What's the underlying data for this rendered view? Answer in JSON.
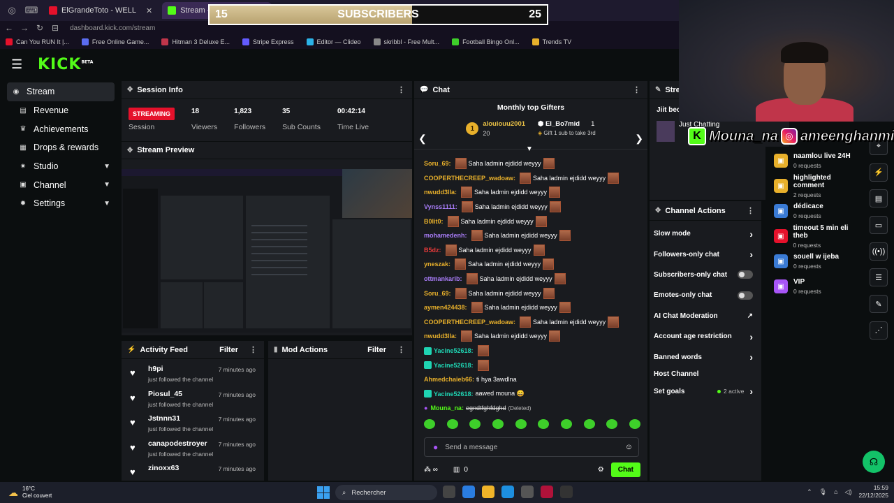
{
  "browser": {
    "tabs": [
      {
        "label": "ElGrandeToto - WELL",
        "active": false
      },
      {
        "label": "Stream - Kick Dashboard",
        "active": true
      }
    ],
    "url": "dashboard.kick.com/stream",
    "bookmarks": [
      "Can You RUN It |...",
      "Free Online Game...",
      "Hitman 3 Deluxe E...",
      "Stripe Express",
      "Editor — Clideo",
      "skribbl - Free Mult...",
      "Football Bingo Onl...",
      "Trends TV"
    ]
  },
  "overlay": {
    "current": "15",
    "title": "SUBSCRIBERS",
    "goal": "25",
    "progress": 0.6,
    "handle": "Mouna_na",
    "instagram": "ameenghanmii"
  },
  "brand": {
    "logo": "KICK",
    "beta": "BETA",
    "accent": "#53fc18"
  },
  "sidebar": {
    "items": [
      {
        "label": "Stream",
        "icon": "broadcast-icon"
      },
      {
        "label": "Revenue",
        "icon": "revenue-icon"
      },
      {
        "label": "Achievements",
        "icon": "trophy-icon"
      },
      {
        "label": "Drops & rewards",
        "icon": "gift-icon"
      },
      {
        "label": "Studio",
        "icon": "gear-icon"
      },
      {
        "label": "Channel",
        "icon": "channel-icon"
      },
      {
        "label": "Settings",
        "icon": "gear-icon"
      }
    ]
  },
  "session": {
    "title": "Session Info",
    "status": "STREAMING",
    "status_label": "Session",
    "stats": [
      {
        "value": "18",
        "label": "Viewers"
      },
      {
        "value": "1,823",
        "label": "Followers"
      },
      {
        "value": "35",
        "label": "Sub Counts"
      },
      {
        "value": "00:42:14",
        "label": "Time Live"
      }
    ]
  },
  "preview": {
    "title": "Stream Preview"
  },
  "activity": {
    "title": "Activity Feed",
    "filter": "Filter",
    "items": [
      {
        "name": "h9pi",
        "action": "just followed the channel",
        "time": "7 minutes ago"
      },
      {
        "name": "Piosul_45",
        "action": "just followed the channel",
        "time": "7 minutes ago"
      },
      {
        "name": "Jstnnn31",
        "action": "just followed the channel",
        "time": "7 minutes ago"
      },
      {
        "name": "canapodestroyer",
        "action": "just followed the channel",
        "time": "7 minutes ago"
      },
      {
        "name": "zinoxx63",
        "action": "",
        "time": "7 minutes ago"
      }
    ]
  },
  "mod": {
    "title": "Mod Actions",
    "filter": "Filter"
  },
  "chat": {
    "title": "Chat",
    "gifters_title": "Monthly top Gifters",
    "top": {
      "rank": "1",
      "name": "alouiouu2001",
      "count": "20"
    },
    "second": {
      "name": "El_Bo7mid",
      "count": "1",
      "note": "Gift 1 sub to take 3rd"
    },
    "messages": [
      {
        "user": "Soru_69:",
        "color": "#e8b02b",
        "text": "Saha ladmin ejdidd weyyy",
        "emotes": true
      },
      {
        "user": "COOPERTHECREEP_wadoaw:",
        "color": "#e8b02b",
        "text": "Saha ladmin ejdidd weyyy",
        "emotes": true
      },
      {
        "user": "nwudd3lla:",
        "color": "#e8b02b",
        "text": "Saha ladmin ejdidd weyyy",
        "emotes": true
      },
      {
        "user": "Vynss1111:",
        "color": "#a87cf7",
        "text": "Saha ladmin ejdidd weyyy",
        "emotes": true
      },
      {
        "user": "B0lit0:",
        "color": "#e8b02b",
        "text": "Saha ladmin ejdidd weyyy",
        "emotes": true
      },
      {
        "user": "mohamedenh:",
        "color": "#a87cf7",
        "text": "Saha ladmin ejdidd weyyy",
        "emotes": true
      },
      {
        "user": "B5dz:",
        "color": "#e83a3a",
        "text": "Saha ladmin ejdidd weyyy",
        "emotes": true
      },
      {
        "user": "yneszak:",
        "color": "#e8b02b",
        "text": "Saha ladmin ejdidd weyyy",
        "emotes": true
      },
      {
        "user": "ottmankarib:",
        "color": "#a87cf7",
        "text": "Saha ladmin ejdidd weyyy",
        "emotes": true
      },
      {
        "user": "Soru_69:",
        "color": "#e8b02b",
        "text": "Saha ladmin ejdidd weyyy",
        "emotes": true
      },
      {
        "user": "aymen424438:",
        "color": "#e8b02b",
        "text": "Saha ladmin ejdidd weyyy",
        "emotes": true
      },
      {
        "user": "COOPERTHECREEP_wadoaw:",
        "color": "#e8b02b",
        "text": "Saha ladmin ejdidd weyyy",
        "emotes": true
      },
      {
        "user": "nwudd3lla:",
        "color": "#e8b02b",
        "text": "Saha ladmin ejdidd weyyy",
        "emotes": true
      },
      {
        "user": "Yacine52618:",
        "color": "#1fd4b3",
        "text": "",
        "emotes": true,
        "badge": true
      },
      {
        "user": "Yacine52618:",
        "color": "#1fd4b3",
        "text": "",
        "emotes": true,
        "badge": true
      },
      {
        "user": "Ahmedchaieb66:",
        "color": "#e8b02b",
        "text": "ti hya 3awdlna",
        "emotes": false
      },
      {
        "user": "Yacine52618:",
        "color": "#1fd4b3",
        "text": "aawed mouna 😄",
        "emotes": false,
        "badge": true
      },
      {
        "user": "Mouna_na:",
        "color": "#53fc18",
        "text": "egndtfghfdghd",
        "emotes": false,
        "deleted": "(Deleted)"
      }
    ],
    "placeholder": "Send a message",
    "send": "Chat",
    "foot_count": "0"
  },
  "stream_panel": {
    "title": "Strea",
    "partial_title": "Jiit bec",
    "category": "Just Chatting"
  },
  "channel_actions": {
    "title": "Channel Actions",
    "items": [
      {
        "label": "Slow mode",
        "kind": "chev"
      },
      {
        "label": "Followers-only chat",
        "kind": "chev"
      },
      {
        "label": "Subscribers-only chat",
        "kind": "toggle"
      },
      {
        "label": "Emotes-only chat",
        "kind": "toggle"
      },
      {
        "label": "AI Chat Moderation",
        "kind": "ext"
      },
      {
        "label": "Account age restriction",
        "kind": "chev"
      },
      {
        "label": "Banned words",
        "kind": "chev"
      },
      {
        "label": "Host Channel",
        "kind": "none"
      },
      {
        "label": "Set goals",
        "kind": "goals",
        "note": "2 active"
      }
    ]
  },
  "rewards": {
    "items": [
      {
        "title": "naamlou live 24H",
        "count": "0 requests",
        "color": "#e8b02b"
      },
      {
        "title": "highlighted comment",
        "count": "2 requests",
        "color": "#e8b02b"
      },
      {
        "title": "dédicace",
        "count": "0 requests",
        "color": "#3a7bd5"
      },
      {
        "title": "timeout 5 min eli theb",
        "count": "0 requests",
        "color": "#e5112b"
      },
      {
        "title": "souell w ijeba",
        "count": "0 requests",
        "color": "#3a7bd5"
      },
      {
        "title": "VIP",
        "count": "0 requests",
        "color": "#a855f7"
      }
    ]
  },
  "taskbar": {
    "temp": "16°C",
    "weather": "Ciel couvert",
    "search": "Rechercher",
    "time": "15:59",
    "date": "22/12/2025"
  }
}
